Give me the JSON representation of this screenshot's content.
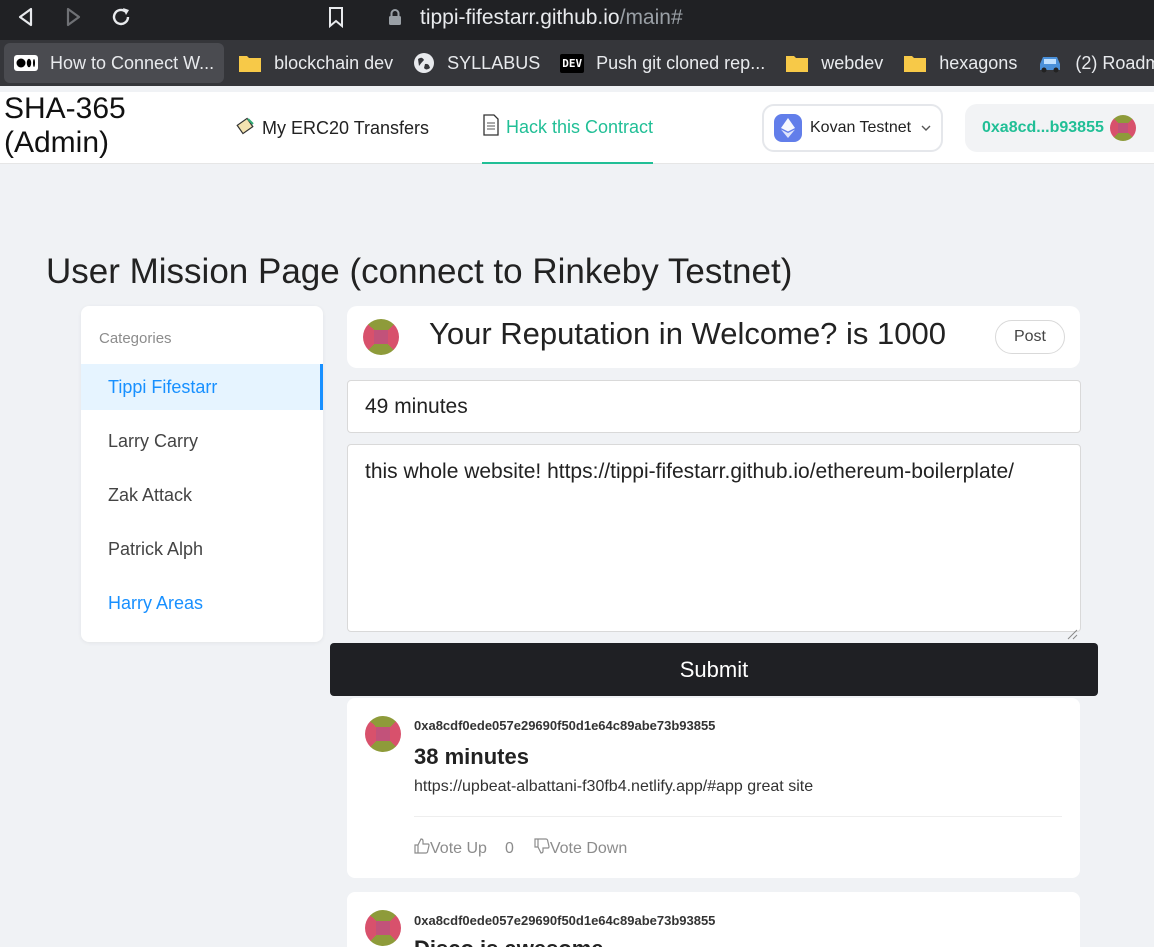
{
  "browser": {
    "url_host": "tippi-fifestarr.github.io",
    "url_path": "/main#",
    "bookmarks": [
      {
        "icon": "medium-icon",
        "label": "How to Connect W..."
      },
      {
        "icon": "folder-icon",
        "label": "blockchain dev"
      },
      {
        "icon": "globe-icon",
        "label": "SYLLABUS"
      },
      {
        "icon": "dev-icon",
        "label": "Push git cloned rep..."
      },
      {
        "icon": "folder-icon",
        "label": "webdev"
      },
      {
        "icon": "folder-icon",
        "label": "hexagons"
      },
      {
        "icon": "car-icon",
        "label": "(2) Roadm"
      }
    ],
    "dev_icon_text": "DEV"
  },
  "header": {
    "brand": "SHA-365 (Admin)",
    "menu": [
      {
        "icon": "pencil-scroll-icon",
        "label": "My ERC20 Transfers"
      },
      {
        "icon": "page-icon",
        "label": "Hack this Contract"
      }
    ],
    "chain": "Kovan Testnet",
    "account": "0xa8cd...b93855",
    "accent_color": "#21bf96"
  },
  "page": {
    "title": "User Mission Page (connect to Rinkeby Testnet)"
  },
  "categories": {
    "heading": "Categories",
    "items": [
      "Tippi Fifestarr",
      "Larry Carry",
      "Zak Attack",
      "Patrick Alph",
      "Harry Areas"
    ],
    "selected": "Tippi Fifestarr"
  },
  "reputation": {
    "text": "Your Reputation in Welcome? is 1000",
    "post_label": "Post"
  },
  "form": {
    "title_value": "49 minutes",
    "body_value": "this whole website! https://tippi-fifestarr.github.io/ethereum-boilerplate/",
    "submit_label": "Submit"
  },
  "posts": [
    {
      "address": "0xa8cdf0ede057e29690f50d1e64c89abe73b93855",
      "title": "38 minutes",
      "body": "https://upbeat-albattani-f30fb4.netlify.app/#app great site",
      "vote_up": "Vote Up",
      "votes": "0",
      "vote_down": "Vote Down"
    },
    {
      "address": "0xa8cdf0ede057e29690f50d1e64c89abe73b93855",
      "title": "Disco is awesome"
    }
  ]
}
